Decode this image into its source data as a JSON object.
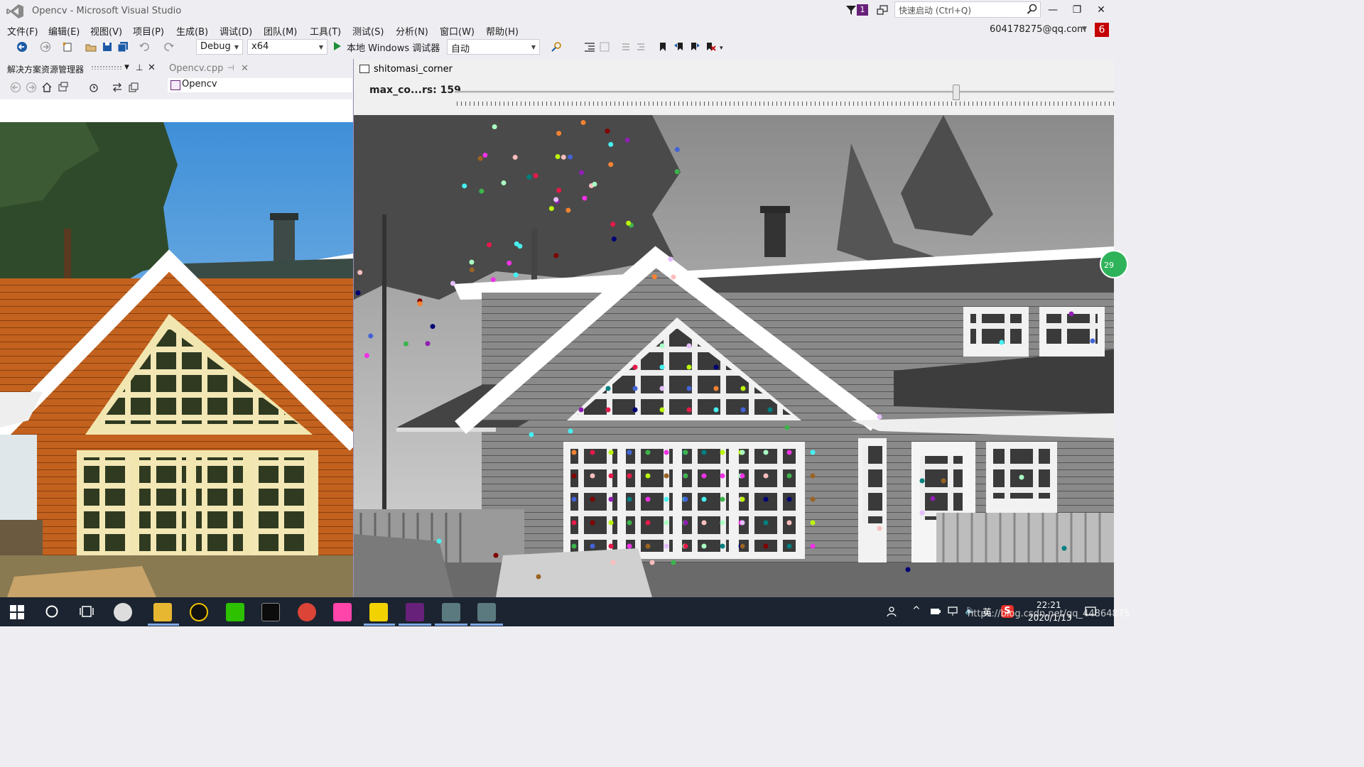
{
  "window": {
    "title": "Opencv - Microsoft Visual Studio",
    "notification_count": "1",
    "quick_launch_placeholder": "快速启动 (Ctrl+Q)",
    "minimize": "—",
    "restore": "❐",
    "close": "✕",
    "account": "604178275@qq.com",
    "account_badge": "6"
  },
  "menu": [
    "文件(F)",
    "编辑(E)",
    "视图(V)",
    "项目(P)",
    "生成(B)",
    "调试(D)",
    "团队(M)",
    "工具(T)",
    "测试(S)",
    "分析(N)",
    "窗口(W)",
    "帮助(H)"
  ],
  "toolbar": {
    "config": "Debug",
    "platform": "x64",
    "run_label": "本地 Windows 调试器",
    "run_mode": "自动"
  },
  "solution_explorer": {
    "title": "解决方案资源管理器",
    "tab": "Opencv.cpp",
    "tab_pin": "⊣",
    "tab_close": "✕",
    "tree_item": "Opencv"
  },
  "image_window": {
    "title": "shitomasi_corner",
    "trackbar_label": "max_co...rs: 159",
    "trackbar_value": 159,
    "trackbar_fraction": 0.755
  },
  "badge_text": "29",
  "taskbar": {
    "time": "22:21",
    "date": "2020/1/13",
    "watermark": "https://blog.csdn.net/qq_44864875",
    "ime": "英"
  },
  "colors": {
    "vs_purple": "#68217a",
    "run_green": "#1e8f3a",
    "taskbar": "#1b2430"
  }
}
